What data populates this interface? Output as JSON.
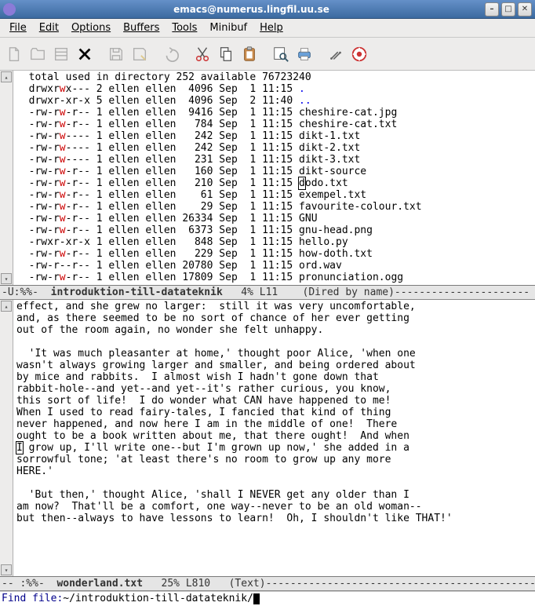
{
  "window": {
    "title": "emacs@numerus.lingfil.uu.se"
  },
  "menu": {
    "file": "File",
    "edit": "Edit",
    "options": "Options",
    "buffers": "Buffers",
    "tools": "Tools",
    "minibuf": "Minibuf",
    "help": "Help"
  },
  "dired": {
    "header": "  total used in directory 252 available 76723240",
    "entries": [
      {
        "perm_a": "drwxr",
        "perm_w": "w",
        "perm_b": "x--- 2 ellen ellen  4096 Sep  1 11:15 ",
        "name": ".",
        "cls": "hlblue"
      },
      {
        "perm_a": "drwxr-xr-x 5 ellen ellen  4096 Sep  2 11:40 ",
        "perm_w": "",
        "perm_b": "",
        "name": "..",
        "cls": "hlblue"
      },
      {
        "perm_a": "-rw-r",
        "perm_w": "w",
        "perm_b": "-r-- 1 ellen ellen  9416 Sep  1 11:15 ",
        "name": "cheshire-cat.jpg"
      },
      {
        "perm_a": "-rw-r",
        "perm_w": "w",
        "perm_b": "-r-- 1 ellen ellen   784 Sep  1 11:15 ",
        "name": "cheshire-cat.txt"
      },
      {
        "perm_a": "-rw-r",
        "perm_w": "w",
        "perm_b": "---- 1 ellen ellen   242 Sep  1 11:15 ",
        "name": "dikt-1.txt"
      },
      {
        "perm_a": "-rw-r",
        "perm_w": "w",
        "perm_b": "---- 1 ellen ellen   242 Sep  1 11:15 ",
        "name": "dikt-2.txt"
      },
      {
        "perm_a": "-rw-r",
        "perm_w": "w",
        "perm_b": "---- 1 ellen ellen   231 Sep  1 11:15 ",
        "name": "dikt-3.txt"
      },
      {
        "perm_a": "-rw-r",
        "perm_w": "w",
        "perm_b": "-r-- 1 ellen ellen   160 Sep  1 11:15 ",
        "name": "dikt-source"
      },
      {
        "perm_a": "-rw-r",
        "perm_w": "w",
        "perm_b": "-r-- 1 ellen ellen   210 Sep  1 11:15 ",
        "name": "dodo.txt",
        "boxfirst": true
      },
      {
        "perm_a": "-rw-r",
        "perm_w": "w",
        "perm_b": "-r-- 1 ellen ellen    61 Sep  1 11:15 ",
        "name": "exempel.txt"
      },
      {
        "perm_a": "-rw-r",
        "perm_w": "w",
        "perm_b": "-r-- 1 ellen ellen    29 Sep  1 11:15 ",
        "name": "favourite-colour.txt"
      },
      {
        "perm_a": "-rw-r",
        "perm_w": "w",
        "perm_b": "-r-- 1 ellen ellen 26334 Sep  1 11:15 ",
        "name": "GNU"
      },
      {
        "perm_a": "-rw-r",
        "perm_w": "w",
        "perm_b": "-r-- 1 ellen ellen  6373 Sep  1 11:15 ",
        "name": "gnu-head.png"
      },
      {
        "perm_a": "-rwxr-xr-x 1 ellen ellen   848 Sep  1 11:15 ",
        "perm_w": "",
        "perm_b": "",
        "name": "hello.py"
      },
      {
        "perm_a": "-rw-r",
        "perm_w": "w",
        "perm_b": "-r-- 1 ellen ellen   229 Sep  1 11:15 ",
        "name": "how-doth.txt"
      },
      {
        "perm_a": "-rw-r--r-- 1 ellen ellen 20780 Sep  1 11:15 ",
        "perm_w": "",
        "perm_b": "",
        "name": "ord.wav"
      },
      {
        "perm_a": "-rw-r",
        "perm_w": "w",
        "perm_b": "-r-- 1 ellen ellen 17809 Sep  1 11:15 ",
        "name": "pronunciation.ogg"
      }
    ]
  },
  "modeline1": {
    "left": "-U:%%-  ",
    "bufname": "introduktion-till-datateknik",
    "right": "   4% L11    (Dired by name)----------------------"
  },
  "text": {
    "lines": [
      "effect, and she grew no larger:  still it was very uncomfortable,",
      "and, as there seemed to be no sort of chance of her ever getting",
      "out of the room again, no wonder she felt unhappy.",
      "",
      "  'It was much pleasanter at home,' thought poor Alice, 'when one",
      "wasn't always growing larger and smaller, and being ordered about",
      "by mice and rabbits.  I almost wish I hadn't gone down that",
      "rabbit-hole--and yet--and yet--it's rather curious, you know,",
      "this sort of life!  I do wonder what CAN have happened to me!",
      "When I used to read fairy-tales, I fancied that kind of thing",
      "never happened, and now here I am in the middle of one!  There",
      "ought to be a book written about me, that there ought!  And when"
    ],
    "boxline_pre": "",
    "boxline_char": "I",
    "boxline_rest": " grow up, I'll write one--but I'm grown up now,' she added in a",
    "lines2": [
      "sorrowful tone; 'at least there's no room to grow up any more",
      "HERE.'",
      "",
      "  'But then,' thought Alice, 'shall I NEVER get any older than I",
      "am now?  That'll be a comfort, one way--never to be an old woman--",
      "but then--always to have lessons to learn!  Oh, I shouldn't like THAT!'"
    ]
  },
  "modeline2": {
    "left": "-- :%%-  ",
    "bufname": "wonderland.txt",
    "right": "   25% L810   (Text)----------------------------------------------"
  },
  "minibuffer": {
    "prompt": "Find file: ",
    "input": "~/introduktion-till-datateknik/"
  }
}
